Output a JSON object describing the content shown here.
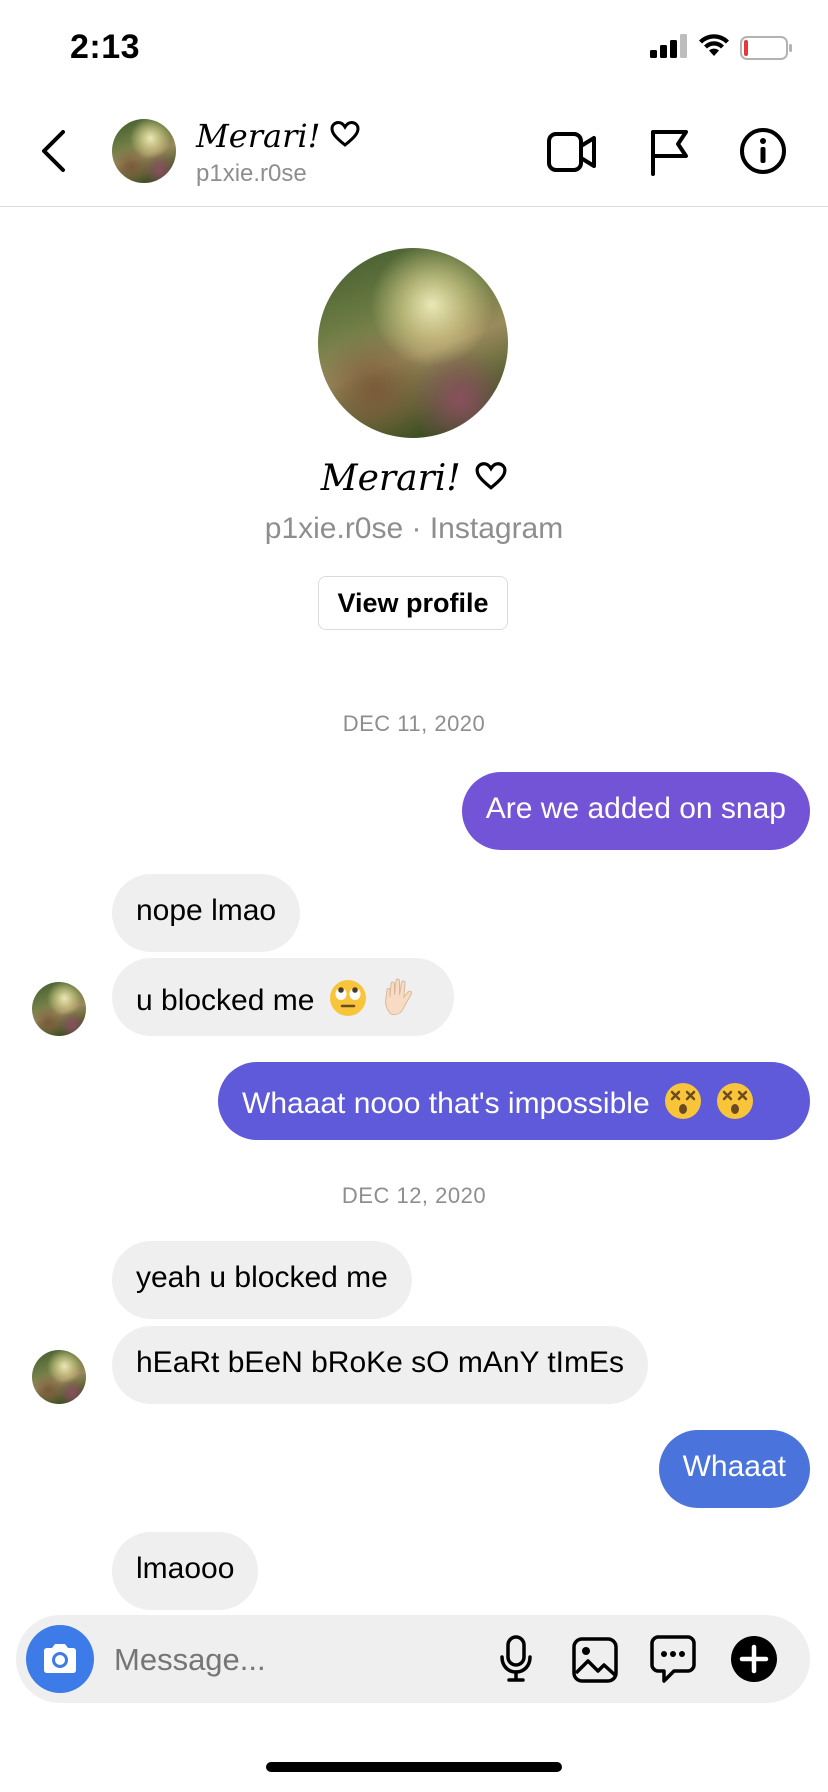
{
  "status_bar": {
    "time": "2:13"
  },
  "header": {
    "display_name": "Merari!",
    "username": "p1xie.r0se"
  },
  "profile_card": {
    "display_name": "Merari!",
    "subtitle": "p1xie.r0se · Instagram",
    "view_profile_label": "View profile"
  },
  "messages": {
    "date1": "DEC 11, 2020",
    "m1": "Are we added on snap",
    "m2": "nope lmao",
    "m3": "u blocked me",
    "m4": "Whaaat nooo that's impossible",
    "date2": "DEC 12, 2020",
    "m5": "yeah u blocked me",
    "m6": "hEaRt bEeN bRoKe sO mAnY tImEs",
    "m7": "Whaaat",
    "m8": "lmaooo"
  },
  "composer": {
    "placeholder": "Message..."
  },
  "colors": {
    "bubble_out_1": "#7353D6",
    "bubble_out_2": "#5E5AD9",
    "bubble_out_3": "#4B73DC",
    "camera_button": "#3D7BE8",
    "incoming_bubble": "#EFEFEF"
  },
  "icons": [
    "back-icon",
    "video-call-icon",
    "flag-icon",
    "info-icon",
    "heart-icon",
    "camera-icon",
    "microphone-icon",
    "gallery-icon",
    "sticker-icon",
    "add-icon",
    "signal-icon",
    "wifi-icon",
    "battery-icon"
  ]
}
